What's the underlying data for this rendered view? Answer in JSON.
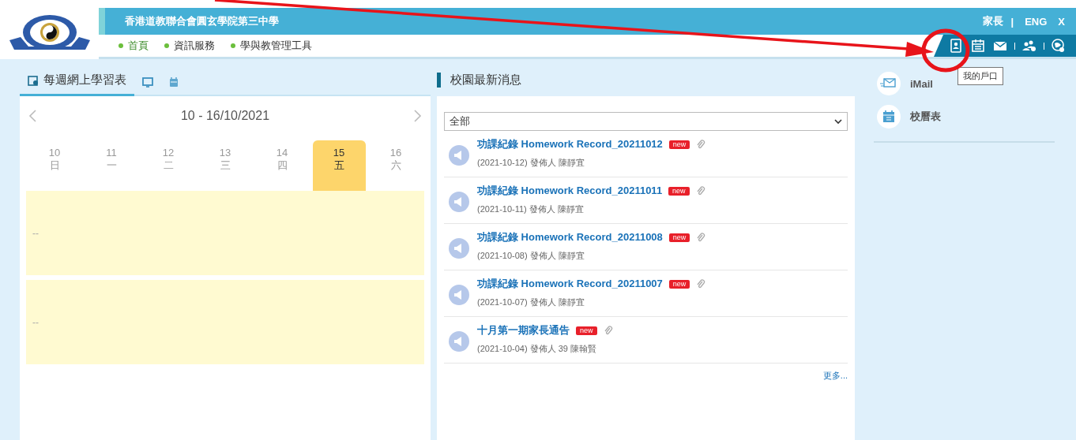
{
  "header": {
    "school_name": "香港道教聯合會圓玄學院第三中學",
    "role": "家長",
    "separator": "|",
    "language": "ENG",
    "close": "X",
    "tooltip": "我的戶口",
    "nav": [
      {
        "label": "首頁",
        "selected": true
      },
      {
        "label": "資訊服務",
        "selected": false
      },
      {
        "label": "學與教管理工具",
        "selected": false
      }
    ]
  },
  "left_panel": {
    "tabs": [
      {
        "kind": "labeled",
        "label": "每週網上學習表",
        "selected": true
      },
      {
        "kind": "monitor",
        "selected": false
      },
      {
        "kind": "calendar",
        "selected": false
      }
    ],
    "range": "10 - 16/10/2021",
    "days": [
      {
        "date": "10",
        "weekday": "日",
        "selected": false
      },
      {
        "date": "11",
        "weekday": "一",
        "selected": false
      },
      {
        "date": "12",
        "weekday": "二",
        "selected": false
      },
      {
        "date": "13",
        "weekday": "三",
        "selected": false
      },
      {
        "date": "14",
        "weekday": "四",
        "selected": false
      },
      {
        "date": "15",
        "weekday": "五",
        "selected": true
      },
      {
        "date": "16",
        "weekday": "六",
        "selected": false
      }
    ],
    "slots": [
      "--",
      "--"
    ]
  },
  "news": {
    "title": "校園最新消息",
    "filter": "全部",
    "more": "更多...",
    "items": [
      {
        "title": "功課紀錄 Homework Record_20211012",
        "badge": "new",
        "meta": "(2021-10-12) 發佈人 陳靜宜"
      },
      {
        "title": "功課紀錄 Homework Record_20211011",
        "badge": "new",
        "meta": "(2021-10-11) 發佈人 陳靜宜"
      },
      {
        "title": "功課紀錄 Homework Record_20211008",
        "badge": "new",
        "meta": "(2021-10-08) 發佈人 陳靜宜"
      },
      {
        "title": "功課紀錄 Homework Record_20211007",
        "badge": "new",
        "meta": "(2021-10-07) 發佈人 陳靜宜"
      },
      {
        "title": "十月第一期家長通告",
        "badge": "new",
        "meta": "(2021-10-04) 發佈人 39 陳翰賢"
      }
    ]
  },
  "shortcuts": [
    {
      "kind": "mail",
      "label": "iMail"
    },
    {
      "kind": "calendar",
      "label": "校曆表"
    }
  ]
}
